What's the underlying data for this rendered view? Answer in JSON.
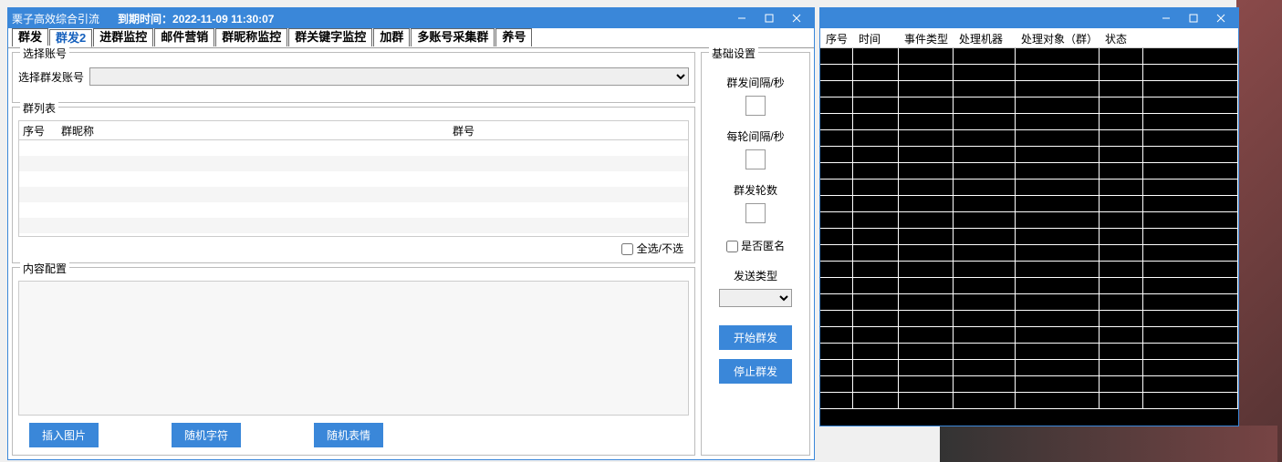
{
  "titlebar": {
    "app_name": "栗子高效综合引流",
    "expire_label": "到期时间：",
    "expire_value": "2022-11-09 11:30:07"
  },
  "tabs": [
    "群发",
    "群发2",
    "进群监控",
    "邮件营销",
    "群昵称监控",
    "群关键字监控",
    "加群",
    "多账号采集群",
    "养号"
  ],
  "active_tab": 1,
  "account": {
    "box_title": "选择账号",
    "label": "选择群发账号"
  },
  "grouplist": {
    "box_title": "群列表",
    "col_index": "序号",
    "col_nick": "群昵称",
    "col_id": "群号",
    "select_all": "全选/不选"
  },
  "content_cfg": {
    "box_title": "内容配置",
    "btn_insert_image": "插入图片",
    "btn_random_text": "随机字符",
    "btn_random_emoji": "随机表情"
  },
  "settings": {
    "box_title": "基础设置",
    "interval_send": "群发间隔/秒",
    "interval_round": "每轮间隔/秒",
    "rounds": "群发轮数",
    "anonymous": "是否匿名",
    "send_type": "发送类型",
    "btn_start": "开始群发",
    "btn_stop": "停止群发"
  },
  "log_cols": {
    "c1": "序号",
    "c2": "时间",
    "c3": "事件类型",
    "c4": "处理机器人",
    "c5": "处理对象（群）",
    "c6": "状态"
  }
}
